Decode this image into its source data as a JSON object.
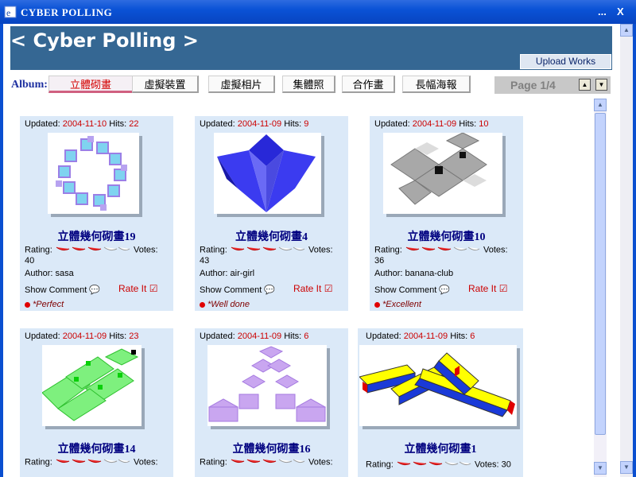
{
  "window": {
    "title": "CYBER POLLING",
    "help": "...",
    "close": "X"
  },
  "header": {
    "title": "< Cyber Polling >",
    "upload_label": "Upload Works"
  },
  "album": {
    "label": "Album:",
    "tabs": [
      "立體砌畫",
      "虛擬裝置",
      "虛擬相片",
      "集體照",
      "合作畫",
      "長幅海報"
    ],
    "active_index": 0
  },
  "pager": {
    "text": "Page 1/4"
  },
  "cards": [
    {
      "updated_label": "Updated:",
      "date": "2004-11-10",
      "hits_label": "Hits:",
      "hits": "22",
      "caption": "立體幾何砌畫19",
      "rating_label": "Rating:",
      "rating": 3,
      "votes_label": "Votes:",
      "votes": "40",
      "author_label": "Author:",
      "author": "sasa",
      "show_comment": "Show Comment",
      "rate_it": "Rate It",
      "comment": "*Perfect"
    },
    {
      "updated_label": "Updated:",
      "date": "2004-11-09",
      "hits_label": "Hits:",
      "hits": "9",
      "caption": "立體幾何砌畫4",
      "rating_label": "Rating:",
      "rating": 3,
      "votes_label": "Votes:",
      "votes": "43",
      "author_label": "Author:",
      "author": "air-girl",
      "show_comment": "Show Comment",
      "rate_it": "Rate It",
      "comment": "*Well done"
    },
    {
      "updated_label": "Updated:",
      "date": "2004-11-09",
      "hits_label": "Hits:",
      "hits": "10",
      "caption": "立體幾何砌畫10",
      "rating_label": "Rating:",
      "rating": 3,
      "votes_label": "Votes:",
      "votes": "36",
      "author_label": "Author:",
      "author": "banana-club",
      "show_comment": "Show Comment",
      "rate_it": "Rate It",
      "comment": "*Excellent"
    },
    {
      "updated_label": "Updated:",
      "date": "2004-11-09",
      "hits_label": "Hits:",
      "hits": "23",
      "caption": "立體幾何砌畫14",
      "rating_label": "Rating:",
      "rating": 3,
      "votes_label": "Votes:",
      "votes": "",
      "author_label": "",
      "author": "",
      "show_comment": "",
      "rate_it": "",
      "comment": ""
    },
    {
      "updated_label": "Updated:",
      "date": "2004-11-09",
      "hits_label": "Hits:",
      "hits": "6",
      "caption": "立體幾何砌畫16",
      "rating_label": "Rating:",
      "rating": 3,
      "votes_label": "Votes:",
      "votes": "",
      "author_label": "",
      "author": "",
      "show_comment": "",
      "rate_it": "",
      "comment": ""
    },
    {
      "updated_label": "Updated:",
      "date": "2004-11-09",
      "hits_label": "Hits:",
      "hits": "6",
      "caption": "立體幾何砌畫1",
      "rating_label": "Rating:",
      "rating": 3,
      "votes_label": "Votes:",
      "votes": "30",
      "author_label": "",
      "author": "",
      "show_comment": "",
      "rate_it": "",
      "comment": ""
    }
  ],
  "colors": {
    "header_bg": "#356793",
    "card_bg": "#dbe9f8",
    "accent_red": "#cc0000",
    "caption": "#000080"
  },
  "icons": {
    "rating": "chili-pepper-icon",
    "comment": "speech-bubble-icon",
    "rate": "checkbox-check-icon"
  }
}
